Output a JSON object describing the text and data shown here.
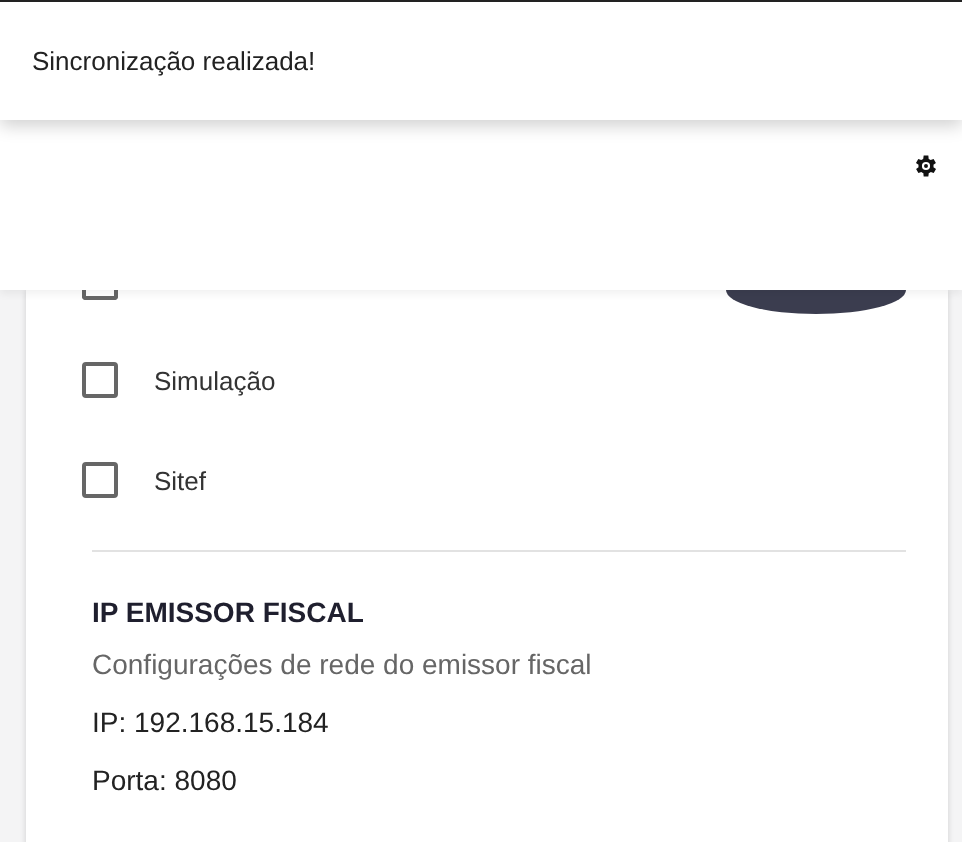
{
  "toast": {
    "message": "Sincronização realizada!"
  },
  "hidden_row": {
    "checked": false
  },
  "options": [
    {
      "label": "Simulação",
      "checked": false
    },
    {
      "label": "Sitef",
      "checked": false
    }
  ],
  "fiscal": {
    "title": "IP EMISSOR FISCAL",
    "subtitle": "Configurações de rede do emissor fiscal",
    "ip": "IP: 192.168.15.184",
    "port": "Porta: 8080"
  }
}
